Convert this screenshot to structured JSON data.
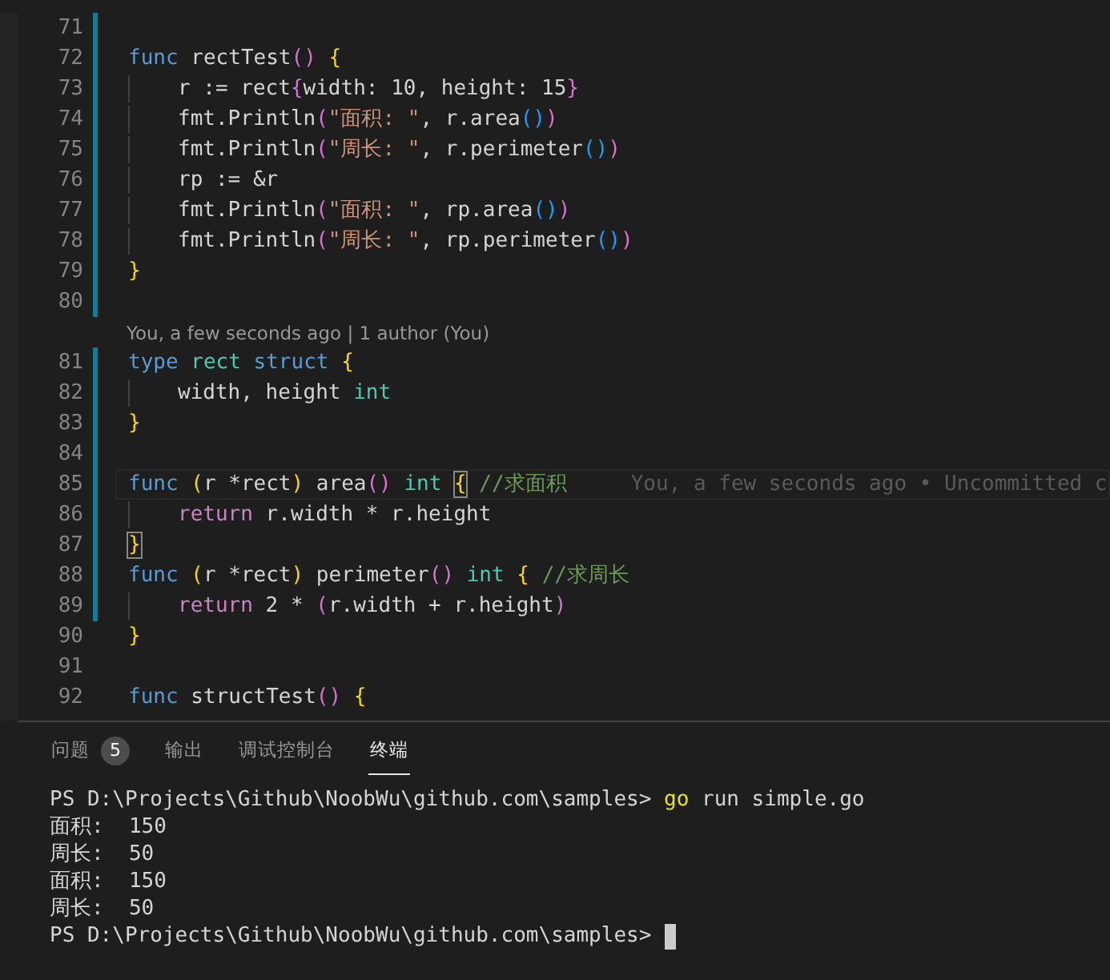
{
  "editor": {
    "lines": [
      {
        "number": "71",
        "modified": true
      },
      {
        "number": "72",
        "modified": true,
        "tokens": [
          {
            "text": "func",
            "kind": "keyword"
          },
          {
            "text": " rectTest",
            "kind": "plain"
          },
          {
            "text": "()",
            "kind": "bracket2"
          },
          {
            "text": " {",
            "kind": "bracket1"
          }
        ]
      },
      {
        "number": "73",
        "modified": true,
        "indented": true,
        "tokens": [
          {
            "text": "r := rect",
            "kind": "plain"
          },
          {
            "text": "{",
            "kind": "bracket2"
          },
          {
            "text": "width: 10, height: 15",
            "kind": "plain"
          },
          {
            "text": "}",
            "kind": "bracket2"
          }
        ]
      },
      {
        "number": "74",
        "modified": true,
        "indented": true,
        "tokens": [
          {
            "text": "fmt.Println",
            "kind": "plain"
          },
          {
            "text": "(",
            "kind": "bracket2"
          },
          {
            "text": "\"面积: \"",
            "kind": "string"
          },
          {
            "text": ", r.area",
            "kind": "plain"
          },
          {
            "text": "()",
            "kind": "bracket3"
          },
          {
            "text": ")",
            "kind": "bracket2"
          }
        ]
      },
      {
        "number": "75",
        "modified": true,
        "indented": true,
        "tokens": [
          {
            "text": "fmt.Println",
            "kind": "plain"
          },
          {
            "text": "(",
            "kind": "bracket2"
          },
          {
            "text": "\"周长: \"",
            "kind": "string"
          },
          {
            "text": ", r.perimeter",
            "kind": "plain"
          },
          {
            "text": "()",
            "kind": "bracket3"
          },
          {
            "text": ")",
            "kind": "bracket2"
          }
        ]
      },
      {
        "number": "76",
        "modified": true,
        "indented": true,
        "tokens": [
          {
            "text": "rp := &r",
            "kind": "plain"
          }
        ]
      },
      {
        "number": "77",
        "modified": true,
        "indented": true,
        "tokens": [
          {
            "text": "fmt.Println",
            "kind": "plain"
          },
          {
            "text": "(",
            "kind": "bracket2"
          },
          {
            "text": "\"面积: \"",
            "kind": "string"
          },
          {
            "text": ", rp.area",
            "kind": "plain"
          },
          {
            "text": "()",
            "kind": "bracket3"
          },
          {
            "text": ")",
            "kind": "bracket2"
          }
        ]
      },
      {
        "number": "78",
        "modified": true,
        "indented": true,
        "tokens": [
          {
            "text": "fmt.Println",
            "kind": "plain"
          },
          {
            "text": "(",
            "kind": "bracket2"
          },
          {
            "text": "\"周长: \"",
            "kind": "string"
          },
          {
            "text": ", rp.perimeter",
            "kind": "plain"
          },
          {
            "text": "()",
            "kind": "bracket3"
          },
          {
            "text": ")",
            "kind": "bracket2"
          }
        ]
      },
      {
        "number": "79",
        "modified": true,
        "tokens": [
          {
            "text": "}",
            "kind": "bracket1"
          }
        ]
      },
      {
        "number": "80",
        "modified": true
      },
      {
        "codelens": "You, a few seconds ago | 1 author (You)"
      },
      {
        "number": "81",
        "modified": true,
        "tokens": [
          {
            "text": "type",
            "kind": "keyword"
          },
          {
            "text": " rect",
            "kind": "type"
          },
          {
            "text": " struct",
            "kind": "keyword"
          },
          {
            "text": " {",
            "kind": "bracket1"
          }
        ]
      },
      {
        "number": "82",
        "modified": true,
        "indented": true,
        "tokens": [
          {
            "text": "width, height ",
            "kind": "plain"
          },
          {
            "text": "int",
            "kind": "type"
          }
        ]
      },
      {
        "number": "83",
        "modified": true,
        "tokens": [
          {
            "text": "}",
            "kind": "bracket1"
          }
        ]
      },
      {
        "number": "84",
        "modified": true
      },
      {
        "number": "85",
        "modified": true,
        "current": true,
        "blame": "You, a few seconds ago • Uncommitted c",
        "tokens": [
          {
            "text": "func",
            "kind": "keyword"
          },
          {
            "text": " (",
            "kind": "bracket1"
          },
          {
            "text": "r *rect",
            "kind": "plain"
          },
          {
            "text": ")",
            "kind": "bracket1"
          },
          {
            "text": " area",
            "kind": "plain"
          },
          {
            "text": "()",
            "kind": "bracket2"
          },
          {
            "text": " int ",
            "kind": "type"
          },
          {
            "text": "{",
            "kind": "match"
          },
          {
            "text": " //求面积",
            "kind": "comment"
          }
        ]
      },
      {
        "number": "86",
        "modified": true,
        "indented": true,
        "tokens": [
          {
            "text": "return",
            "kind": "control"
          },
          {
            "text": " r.width * r.height",
            "kind": "plain"
          }
        ]
      },
      {
        "number": "87",
        "modified": true,
        "tokens": [
          {
            "text": "}",
            "kind": "match"
          }
        ]
      },
      {
        "number": "88",
        "modified": true,
        "tokens": [
          {
            "text": "func",
            "kind": "keyword"
          },
          {
            "text": " (",
            "kind": "bracket1"
          },
          {
            "text": "r *rect",
            "kind": "plain"
          },
          {
            "text": ")",
            "kind": "bracket1"
          },
          {
            "text": " perimeter",
            "kind": "plain"
          },
          {
            "text": "()",
            "kind": "bracket2"
          },
          {
            "text": " int",
            "kind": "type"
          },
          {
            "text": " {",
            "kind": "bracket1"
          },
          {
            "text": " //求周长",
            "kind": "comment"
          }
        ]
      },
      {
        "number": "89",
        "modified": true,
        "indented": true,
        "tokens": [
          {
            "text": "return",
            "kind": "control"
          },
          {
            "text": " 2 * ",
            "kind": "plain"
          },
          {
            "text": "(",
            "kind": "bracket2"
          },
          {
            "text": "r.width + r.height",
            "kind": "plain"
          },
          {
            "text": ")",
            "kind": "bracket2"
          }
        ]
      },
      {
        "number": "90",
        "modified": false,
        "tokens": [
          {
            "text": "}",
            "kind": "bracket1"
          }
        ]
      },
      {
        "number": "91",
        "modified": false
      },
      {
        "number": "92",
        "modified": false,
        "tokens": [
          {
            "text": "func",
            "kind": "keyword"
          },
          {
            "text": " structTest",
            "kind": "plain"
          },
          {
            "text": "()",
            "kind": "bracket2"
          },
          {
            "text": " {",
            "kind": "bracket1"
          }
        ]
      }
    ]
  },
  "panel": {
    "tabs": [
      {
        "label": "问题",
        "badge": "5",
        "selected": false
      },
      {
        "label": "输出",
        "selected": false
      },
      {
        "label": "调试控制台",
        "selected": false
      },
      {
        "label": "终端",
        "selected": true
      }
    ],
    "terminal": [
      {
        "tokens": [
          {
            "text": "PS D:\\Projects\\Github\\NoobWu\\github.com\\samples> ",
            "kind": "plain"
          },
          {
            "text": "go",
            "kind": "command"
          },
          {
            "text": " run simple.go",
            "kind": "plain"
          }
        ]
      },
      {
        "tokens": [
          {
            "text": "面积:  150",
            "kind": "plain"
          }
        ]
      },
      {
        "tokens": [
          {
            "text": "周长:  50",
            "kind": "plain"
          }
        ]
      },
      {
        "tokens": [
          {
            "text": "面积:  150",
            "kind": "plain"
          }
        ]
      },
      {
        "tokens": [
          {
            "text": "周长:  50",
            "kind": "plain"
          }
        ]
      },
      {
        "tokens": [
          {
            "text": "PS D:\\Projects\\Github\\NoobWu\\github.com\\samples>",
            "kind": "plain"
          }
        ],
        "cursor": true
      }
    ]
  }
}
